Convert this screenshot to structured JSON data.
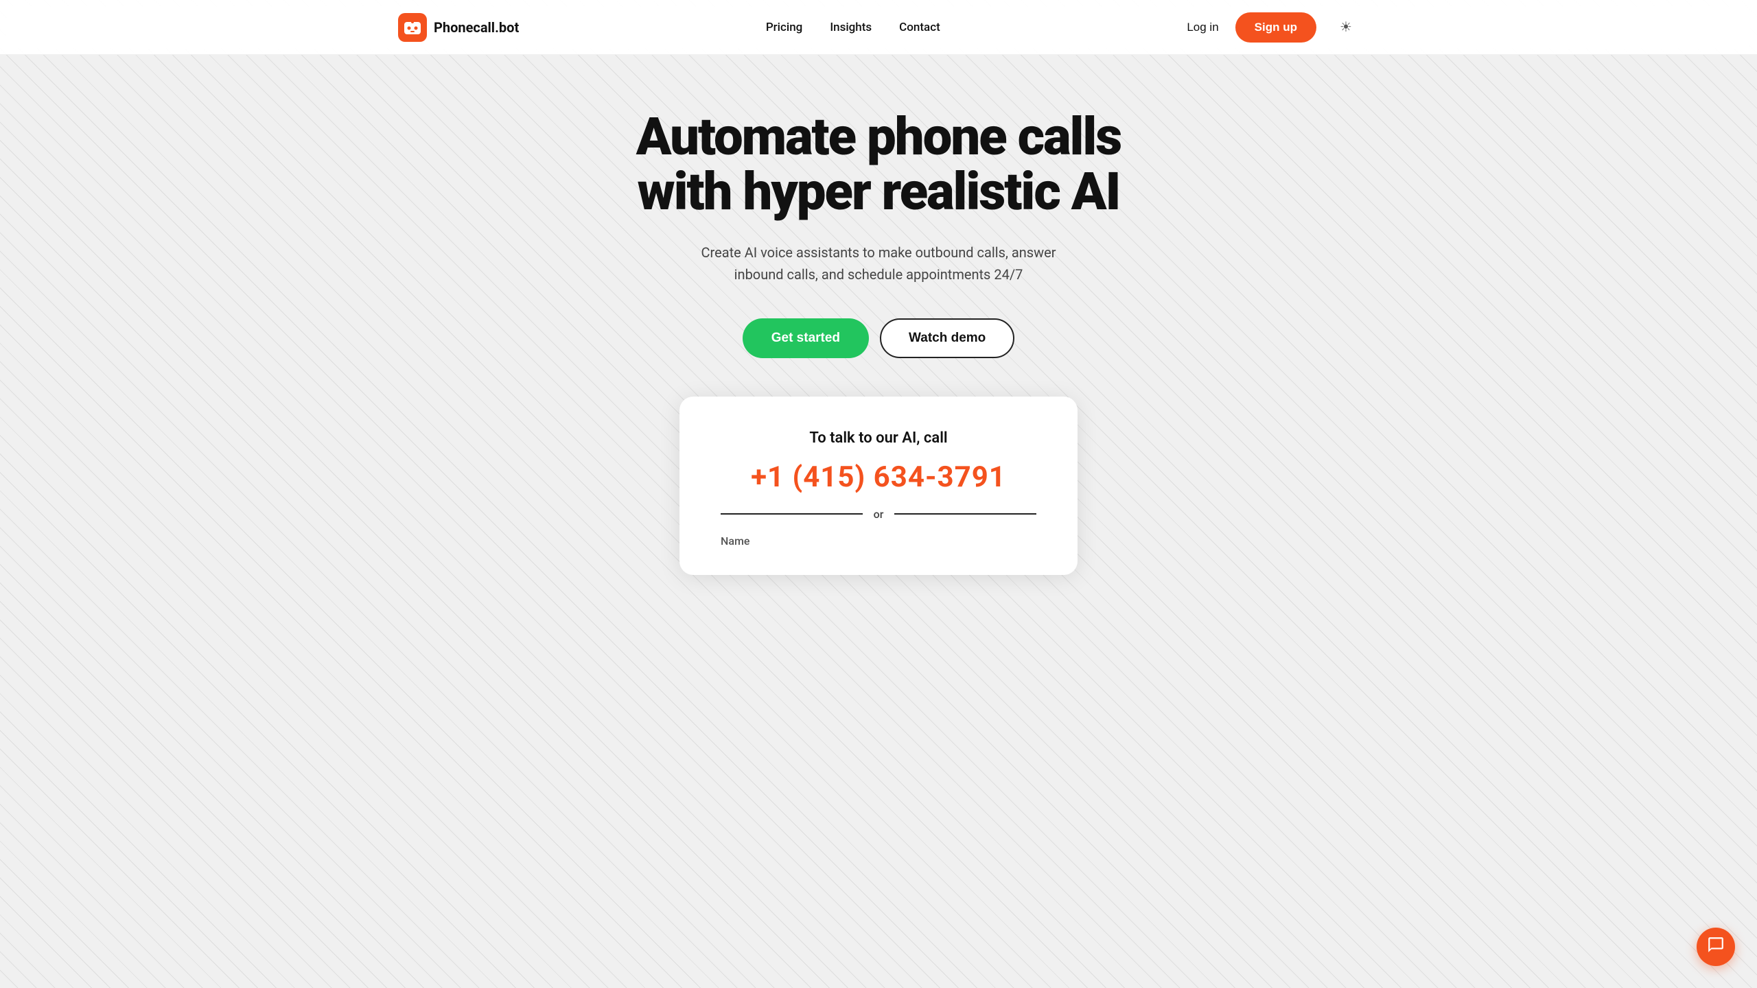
{
  "nav": {
    "logo_text": "Phonecall.bot",
    "links": [
      {
        "label": "Pricing",
        "id": "pricing"
      },
      {
        "label": "Insights",
        "id": "insights"
      },
      {
        "label": "Contact",
        "id": "contact"
      }
    ],
    "login_label": "Log in",
    "signup_label": "Sign up",
    "theme_icon": "☀"
  },
  "hero": {
    "title_line1": "Automate phone calls",
    "title_line2": "with hyper realistic AI",
    "subtitle": "Create AI voice assistants to make outbound calls, answer inbound calls, and schedule appointments 24/7",
    "cta_primary": "Get started",
    "cta_secondary": "Watch demo"
  },
  "call_card": {
    "label": "To talk to our AI, call",
    "phone": "+1 (415) 634-3791",
    "divider_text": "or",
    "name_label": "Name"
  },
  "chat": {
    "icon": "💬"
  }
}
